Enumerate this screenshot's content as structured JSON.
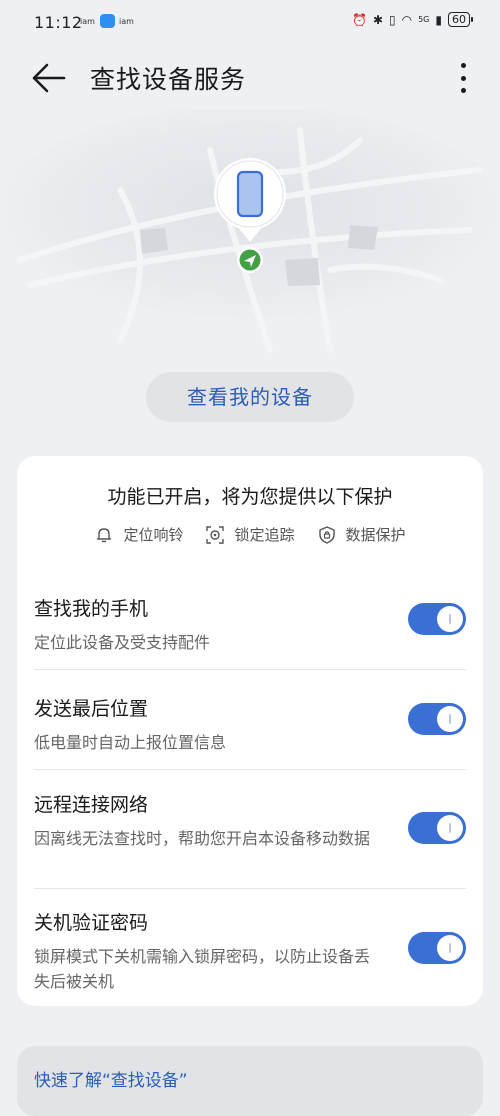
{
  "status": {
    "time": "11:12",
    "carrier1": "iam",
    "carrier2": "iam",
    "network": "5G",
    "battery": "60"
  },
  "header": {
    "title": "查找设备服务"
  },
  "map": {
    "view_button": "查看我的设备"
  },
  "card": {
    "headline": "功能已开启，将为您提供以下保护",
    "features": [
      "定位响铃",
      "锁定追踪",
      "数据保护"
    ],
    "settings": [
      {
        "title": "查找我的手机",
        "subtitle": "定位此设备及受支持配件",
        "enabled": true
      },
      {
        "title": "发送最后位置",
        "subtitle": "低电量时自动上报位置信息",
        "enabled": true
      },
      {
        "title": "远程连接网络",
        "subtitle": "因离线无法查找时，帮助您开启本设备移动数据",
        "enabled": true
      },
      {
        "title": "关机验证密码",
        "subtitle": "锁屏模式下关机需输入锁屏密码，以防止设备丢失后被关机",
        "enabled": true
      }
    ]
  },
  "learn_more": "快速了解“查找设备”",
  "colors": {
    "accent": "#3a6fd3",
    "link": "#2b5eb4",
    "location_green": "#43a047"
  }
}
